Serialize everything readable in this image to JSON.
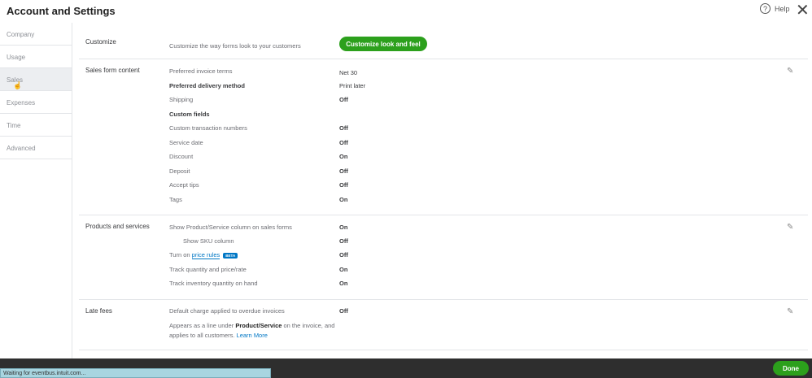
{
  "title": "Account and Settings",
  "help_label": "Help",
  "sidebar": [
    "Company",
    "Usage",
    "Sales",
    "Expenses",
    "Time",
    "Advanced"
  ],
  "customize": {
    "label": "Customize",
    "desc": "Customize the way forms look to your customers",
    "button": "Customize look and feel"
  },
  "sales_form": {
    "label": "Sales form content",
    "rows": [
      {
        "name": "Preferred invoice terms",
        "value": "Net 30"
      },
      {
        "name": "Preferred delivery method",
        "value": "Print later"
      },
      {
        "name": "Shipping",
        "value": "Off"
      },
      {
        "name": "Custom fields",
        "value": ""
      },
      {
        "name": "Custom transaction numbers",
        "value": "Off"
      },
      {
        "name": "Service date",
        "value": "Off"
      },
      {
        "name": "Discount",
        "value": "On"
      },
      {
        "name": "Deposit",
        "value": "Off"
      },
      {
        "name": "Accept tips",
        "value": "Off"
      },
      {
        "name": "Tags",
        "value": "On"
      }
    ]
  },
  "products": {
    "label": "Products and services",
    "rows": [
      {
        "name": "Show Product/Service column on sales forms",
        "value": "On"
      },
      {
        "name": "Show SKU column",
        "value": "Off"
      },
      {
        "name": "Turn on",
        "link": "price rules",
        "badge": "BETA",
        "value": "Off"
      },
      {
        "name": "Track quantity and price/rate",
        "value": "On"
      },
      {
        "name": "Track inventory quantity on hand",
        "value": "On"
      }
    ]
  },
  "late_fees": {
    "label": "Late fees",
    "row": "Default charge applied to overdue invoices",
    "value": "Off",
    "note_pre": "Appears as a line under ",
    "note_bold": "Product/Service",
    "note_post": " on the invoice, and applies to all customers. ",
    "note_link": "Learn More"
  },
  "done": "Done",
  "status": "Waiting for eventbus.intuit.com..."
}
